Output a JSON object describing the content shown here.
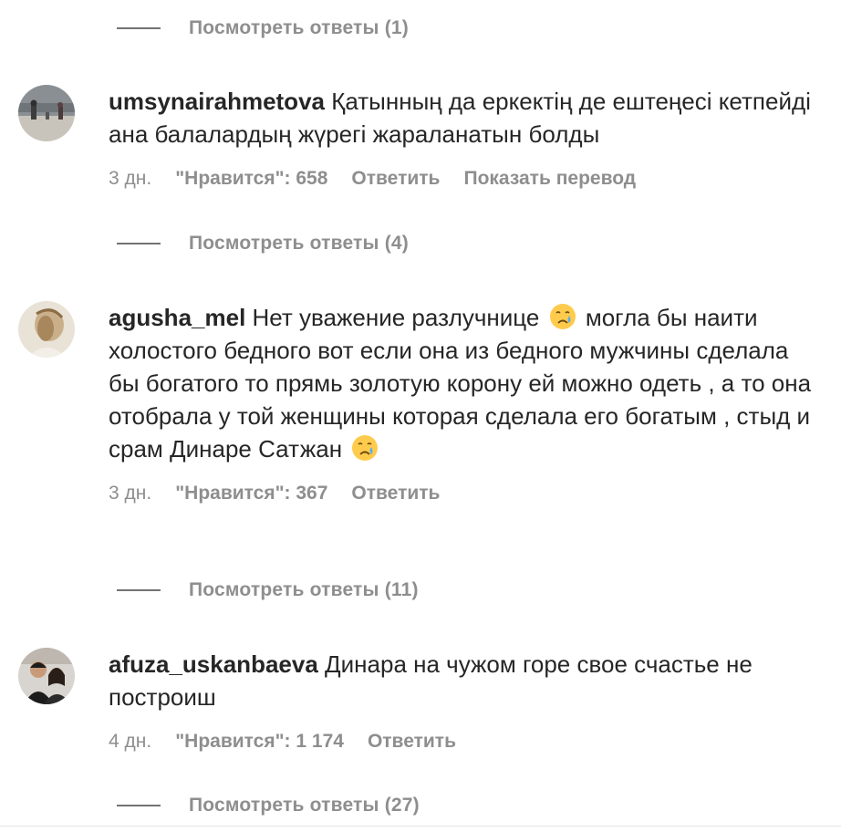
{
  "comments": [
    {
      "username": "umsynairahmetova",
      "text_parts": [
        "Қатынның да еркектің де ештеңесі кетпейді ана балалардың жүрегі жараланатын болды"
      ],
      "time": "3 дн.",
      "likes": "\"Нравится\": 658",
      "reply": "Ответить",
      "translate": "Показать перевод",
      "view_replies": "Посмотреть ответы (4)"
    },
    {
      "username": "agusha_mel",
      "text_parts": [
        "Нет уважение разлучнице",
        "могла бы наити холостого бедного вот если она из бедного мужчины сделала бы богатого то прямь золотую корону ей можно одеть , а то она отобрала у той женщины которая сделала его богатым , стыд и срам Динаре Сатжан"
      ],
      "emoji": "crying-face",
      "time": "3 дн.",
      "likes": "\"Нравится\": 367",
      "reply": "Ответить",
      "view_replies": "Посмотреть ответы (11)"
    },
    {
      "username": "afuza_uskanbaeva",
      "text_parts": [
        "Динара на чужом горе свое счастье не построиш"
      ],
      "time": "4 дн.",
      "likes": "\"Нравится\": 1 174",
      "reply": "Ответить",
      "view_replies": "Посмотреть ответы (27)"
    }
  ],
  "top_view_replies": "Посмотреть ответы (1)",
  "colors": {
    "text": "#262626",
    "secondary": "#8e8e8e",
    "divider": "#737373"
  }
}
